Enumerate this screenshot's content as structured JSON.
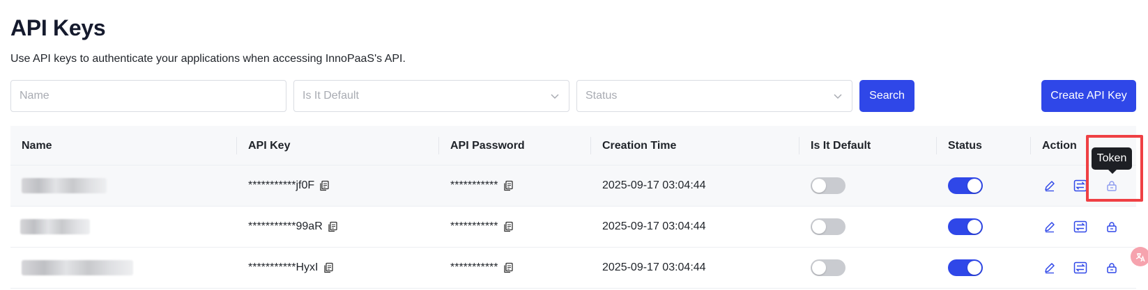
{
  "header": {
    "title": "API Keys",
    "description": "Use API keys to authenticate your applications when accessing InnoPaaS's API."
  },
  "filters": {
    "name_placeholder": "Name",
    "default_placeholder": "Is It Default",
    "status_placeholder": "Status",
    "search_label": "Search",
    "create_label": "Create API Key"
  },
  "table": {
    "columns": [
      "Name",
      "API Key",
      "API Password",
      "Creation Time",
      "Is It Default",
      "Status",
      "Action"
    ],
    "rows": [
      {
        "api_key": "***********jf0F",
        "api_password": "***********",
        "creation_time": "2025-09-17 03:04:44",
        "is_default": false,
        "status": true
      },
      {
        "api_key": "***********99aR",
        "api_password": "***********",
        "creation_time": "2025-09-17 03:04:44",
        "is_default": false,
        "status": true
      },
      {
        "api_key": "***********HyxI",
        "api_password": "***********",
        "creation_time": "2025-09-17 03:04:44",
        "is_default": false,
        "status": true
      }
    ]
  },
  "tooltip": {
    "text": "Token"
  },
  "icons": {
    "copy": "copy-icon",
    "edit": "edit-icon",
    "switch": "switch-icon",
    "token": "lock-icon",
    "chevron": "chevron-down-icon",
    "floating": "translate-icon"
  },
  "colors": {
    "accent": "#2f47e8",
    "toggle_off": "#c9cbd0",
    "highlight": "#ef4044",
    "tooltip_bg": "#1d1f24"
  }
}
